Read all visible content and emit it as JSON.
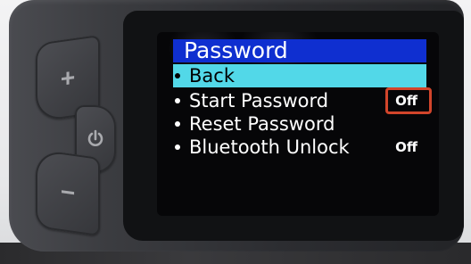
{
  "menu": {
    "title": "Password",
    "items": [
      {
        "label": "Back",
        "value": "",
        "selected": true
      },
      {
        "label": "Start Password",
        "value": "Off",
        "selected": false
      },
      {
        "label": "Reset Password",
        "value": "",
        "selected": false
      },
      {
        "label": "Bluetooth Unlock",
        "value": "Off",
        "selected": false
      }
    ]
  },
  "buttons": {
    "plus_symbol": "+",
    "minus_symbol": "−",
    "power_icon": "power-icon"
  },
  "colors": {
    "title_bar": "#0f2fd0",
    "selected_row": "#52d8e8",
    "highlight_box": "#d2452b"
  }
}
